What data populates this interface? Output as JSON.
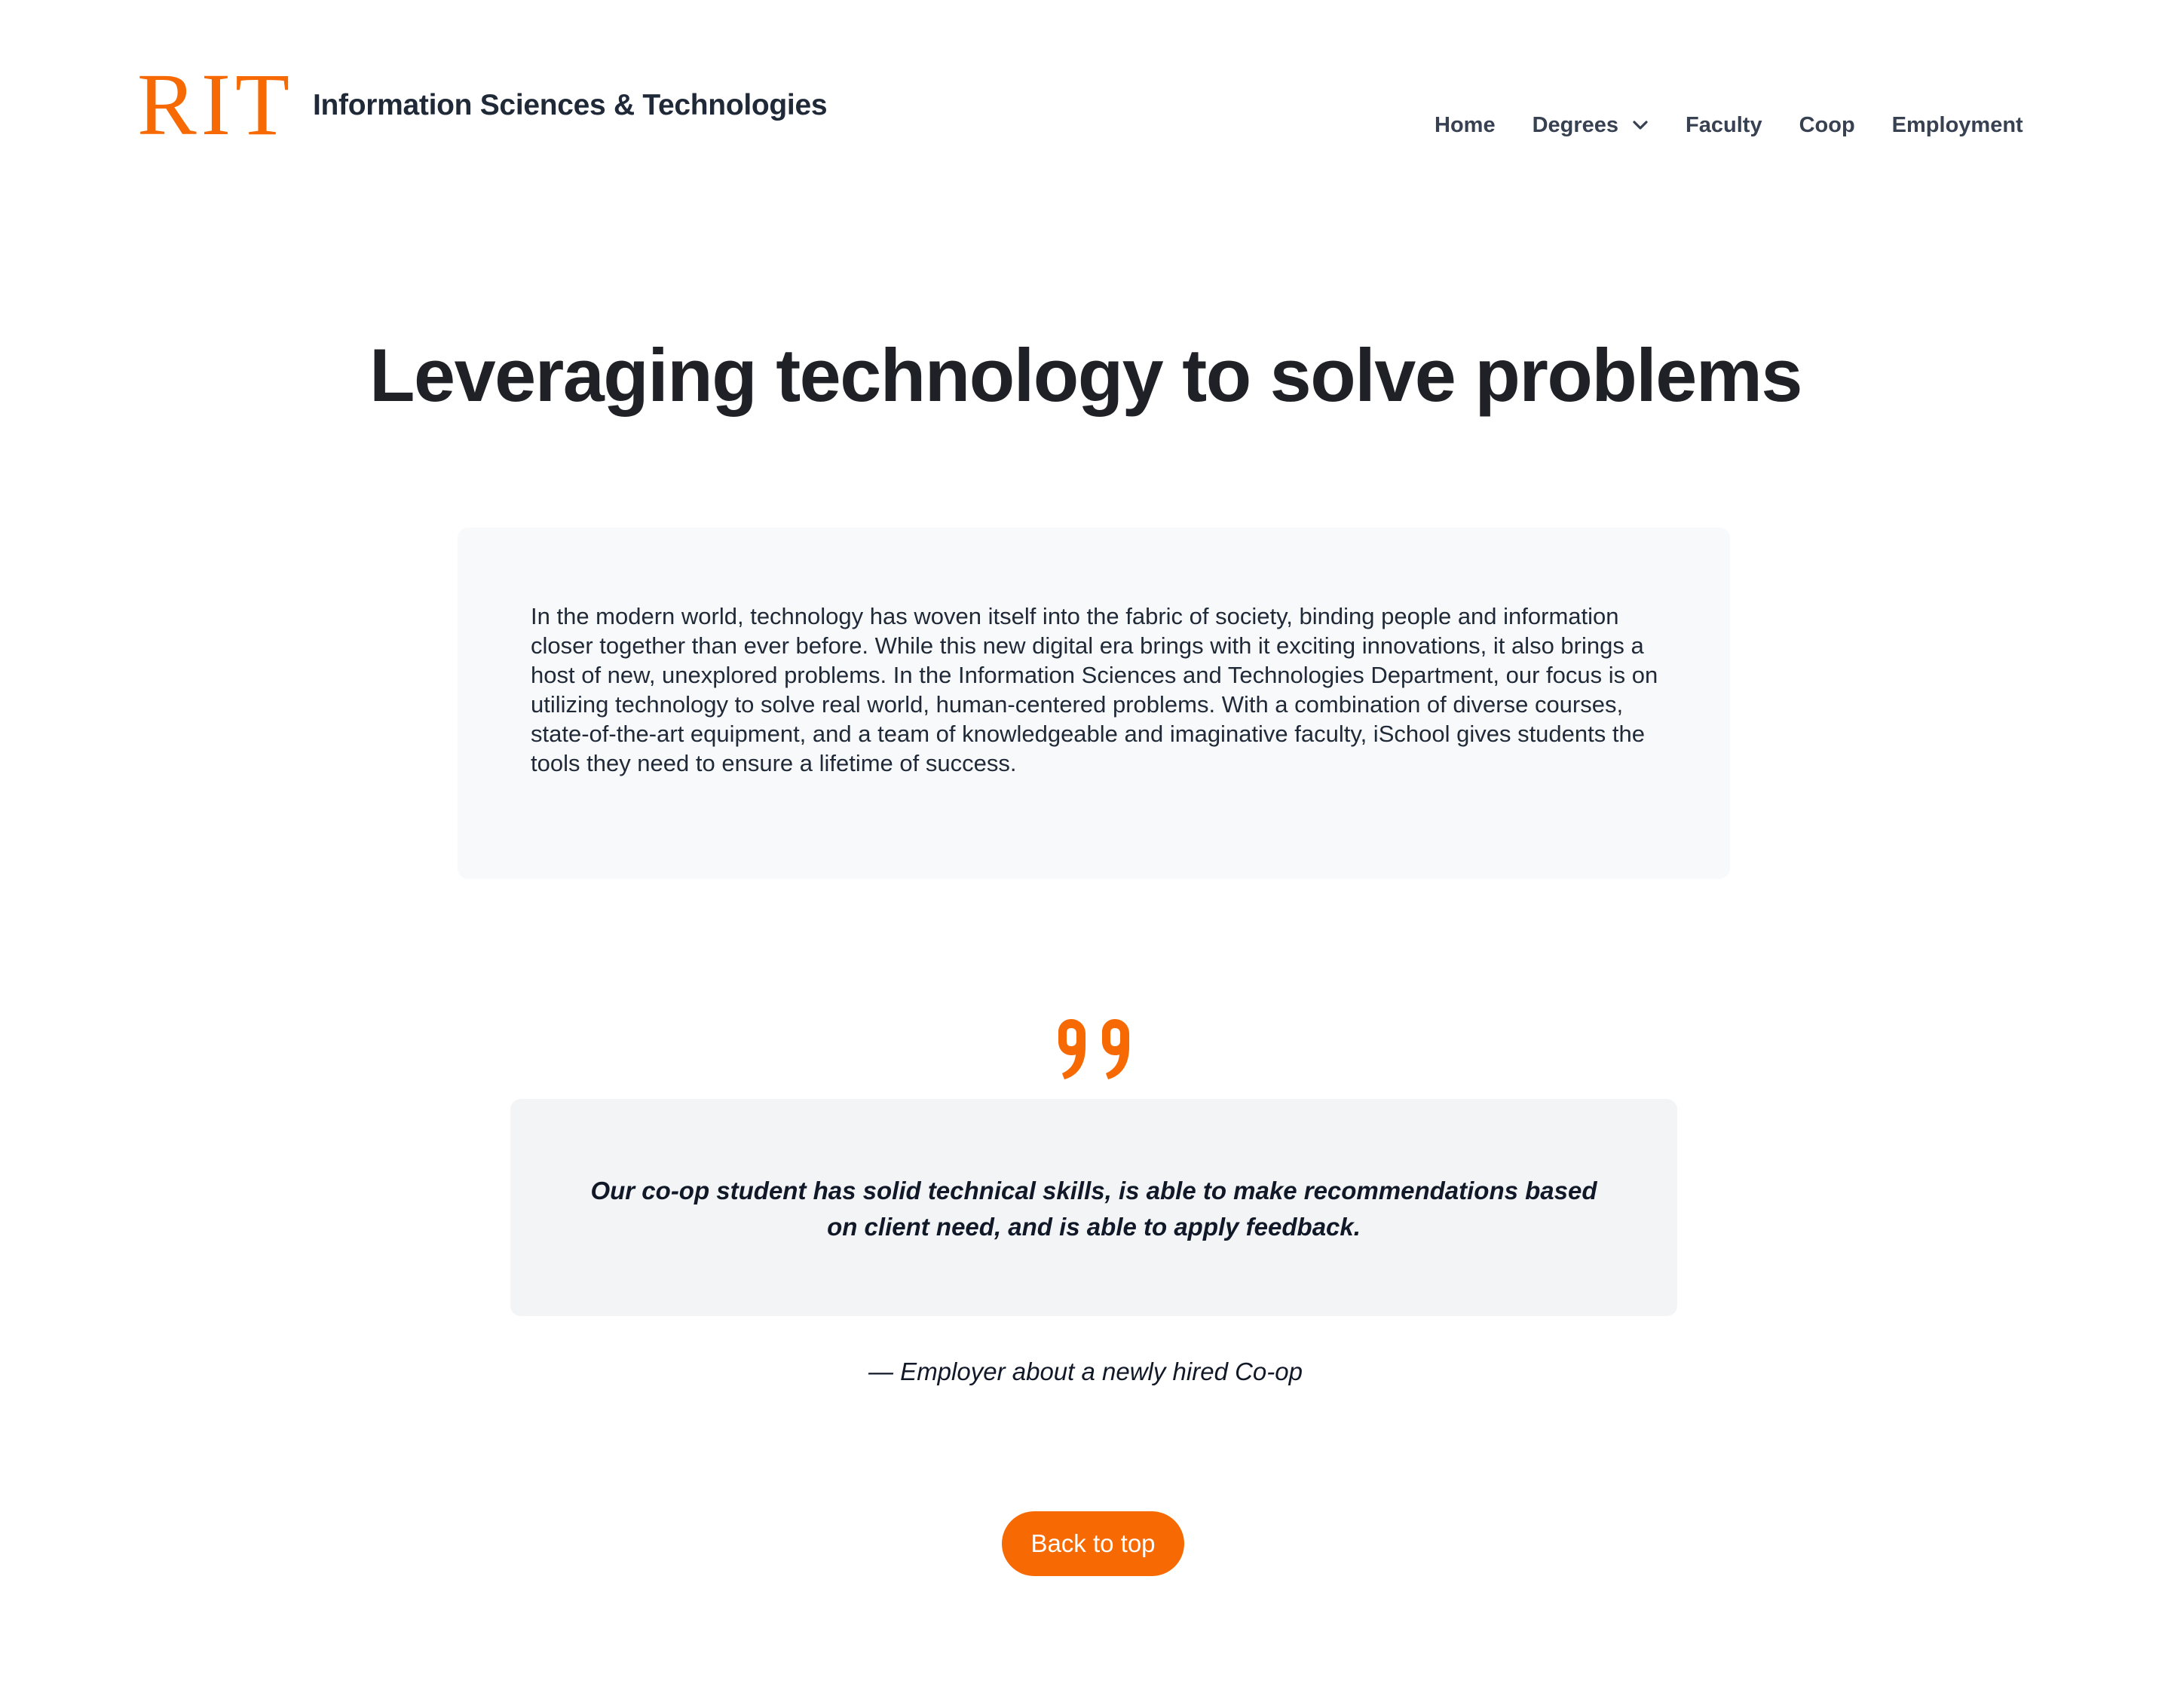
{
  "header": {
    "logo_text": "RIT",
    "site_title": "Information Sciences & Technologies"
  },
  "nav": {
    "items": [
      {
        "label": "Home"
      },
      {
        "label": "Degrees",
        "has_dropdown": true,
        "icon": "chevron-down-icon"
      },
      {
        "label": "Faculty"
      },
      {
        "label": "Coop"
      },
      {
        "label": "Employment"
      }
    ]
  },
  "hero": {
    "title": "Leveraging technology to solve problems"
  },
  "intro": {
    "text": "In the modern world, technology has woven itself into the fabric of society, binding people and information closer together than ever before. While this new digital era brings with it exciting innovations, it also brings a host of new, unexplored problems. In the Information Sciences and Technologies Department, our focus is on utilizing technology to solve real world, human-centered problems. With a combination of diverse courses, state-of-the-art equipment, and a team of knowledgeable and imaginative faculty, iSchool gives students the tools they need to ensure a lifetime of success."
  },
  "testimonial": {
    "icon": "quote-icon",
    "quote": "Our co-op student has solid technical skills, is able to make recommendations based on client need, and is able to apply feedback.",
    "attribution": "— Employer about a newly hired Co-op"
  },
  "footer": {
    "back_to_top_label": "Back to top"
  },
  "colors": {
    "brand_orange": "#f76902",
    "intro_card_bg": "#f8f9fa",
    "quote_card_bg": "#f3f4f6",
    "heading": "#1f2126"
  }
}
